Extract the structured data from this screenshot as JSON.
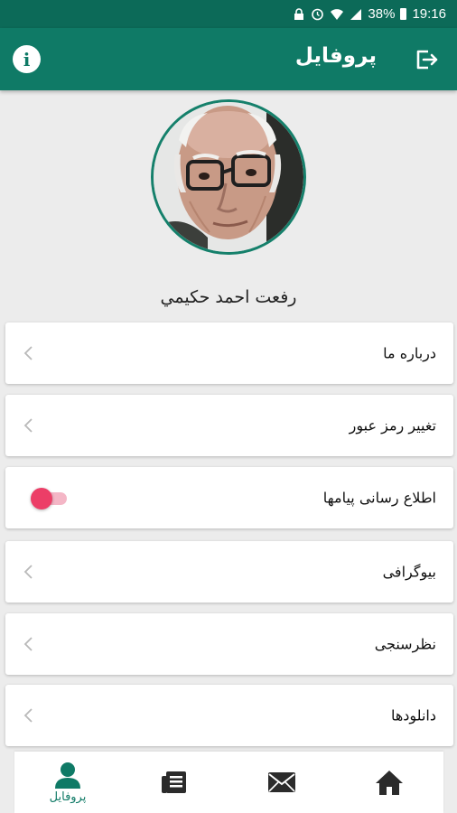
{
  "status_bar": {
    "battery": "38%",
    "time": "19:16"
  },
  "app_bar": {
    "title": "پروفایل"
  },
  "profile": {
    "name": "رفعت احمد حکیمي"
  },
  "menu": [
    {
      "label": "درباره ما",
      "control": "chevron"
    },
    {
      "label": "تغيير رمز عبور",
      "control": "chevron"
    },
    {
      "label": "اطلاع رسانی پیامها",
      "control": "toggle",
      "toggle_on": true
    },
    {
      "label": "بیوگرافی",
      "control": "chevron"
    },
    {
      "label": "نظرسنجی",
      "control": "chevron"
    },
    {
      "label": "دانلودها",
      "control": "chevron"
    }
  ],
  "bottom_nav": {
    "profile_label": "پروفایل",
    "items": [
      "home-icon",
      "mail-icon",
      "news-icon",
      "profile-icon"
    ]
  },
  "colors": {
    "primary": "#0f7a66",
    "status_bar": "#0c6a58",
    "accent": "#ec3e67",
    "background": "#ececec"
  }
}
